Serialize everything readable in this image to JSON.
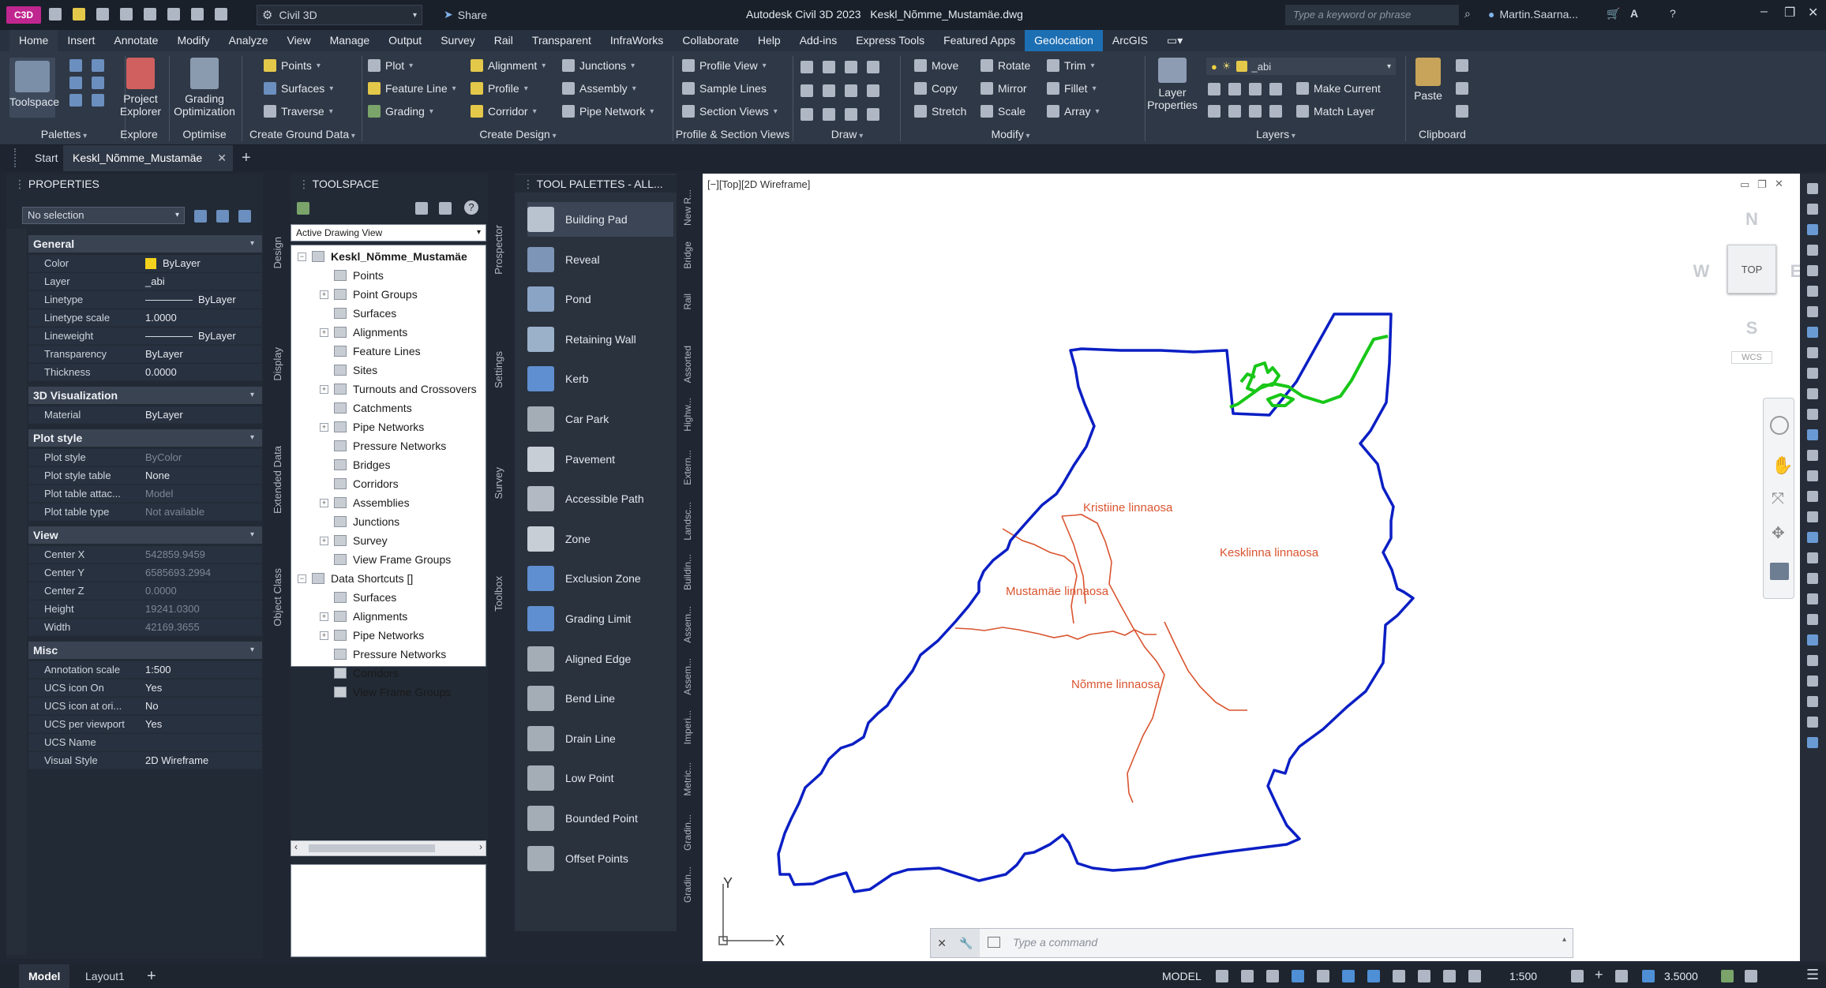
{
  "titlebar": {
    "app_badge": "C3D",
    "workspace": "Civil 3D",
    "share": "Share",
    "title": "Autodesk Civil 3D 2023",
    "file": "Keskl_Nõmme_Mustamäe.dwg",
    "search_placeholder": "Type a keyword or phrase",
    "user": "Martin.Saarna..."
  },
  "menu": [
    "Home",
    "Insert",
    "Annotate",
    "Modify",
    "Analyze",
    "View",
    "Manage",
    "Output",
    "Survey",
    "Rail",
    "Transparent",
    "InfraWorks",
    "Collaborate",
    "Help",
    "Add-ins",
    "Express Tools",
    "Featured Apps",
    "Geolocation",
    "ArcGIS"
  ],
  "ribbon": {
    "palettes": {
      "toolspace": "Toolspace",
      "label": "Palettes"
    },
    "explore": {
      "project_explorer_1": "Project",
      "project_explorer_2": "Explorer",
      "label": "Explore"
    },
    "optimise": {
      "grading_1": "Grading",
      "grading_2": "Optimization",
      "label": "Optimise"
    },
    "ground": {
      "points": "Points",
      "surfaces": "Surfaces",
      "traverse": "Traverse",
      "label": "Create Ground Data"
    },
    "design": {
      "plot": "Plot",
      "feature_line": "Feature Line",
      "grading": "Grading",
      "alignment": "Alignment",
      "profile": "Profile",
      "corridor": "Corridor",
      "junctions": "Junctions",
      "assembly": "Assembly",
      "pipe_network": "Pipe Network",
      "label": "Create Design"
    },
    "profile_views": {
      "profile_view": "Profile View",
      "sample_lines": "Sample Lines",
      "section_views": "Section Views",
      "label": "Profile & Section Views"
    },
    "draw": {
      "label": "Draw"
    },
    "modify": {
      "move": "Move",
      "copy": "Copy",
      "stretch": "Stretch",
      "rotate": "Rotate",
      "mirror": "Mirror",
      "scale": "Scale",
      "trim": "Trim",
      "fillet": "Fillet",
      "array": "Array",
      "label": "Modify"
    },
    "layers": {
      "layer_1": "Layer",
      "layer_2": "Properties",
      "current_layer": "_abi",
      "make_current": "Make Current",
      "match_layer": "Match Layer",
      "label": "Layers"
    },
    "clipboard": {
      "paste": "Paste",
      "label": "Clipboard"
    }
  },
  "doctabs": {
    "start": "Start",
    "active": "Keskl_Nõmme_Mustamäe"
  },
  "properties": {
    "header": "PROPERTIES",
    "selection": "No selection",
    "sections": [
      {
        "title": "General",
        "rows": [
          [
            "Color",
            "ByLayer"
          ],
          [
            "Layer",
            "_abi"
          ],
          [
            "Linetype",
            "ByLayer"
          ],
          [
            "Linetype scale",
            "1.0000"
          ],
          [
            "Lineweight",
            "ByLayer"
          ],
          [
            "Transparency",
            "ByLayer"
          ],
          [
            "Thickness",
            "0.0000"
          ]
        ]
      },
      {
        "title": "3D Visualization",
        "rows": [
          [
            "Material",
            "ByLayer"
          ]
        ]
      },
      {
        "title": "Plot style",
        "rows": [
          [
            "Plot style",
            "ByColor"
          ],
          [
            "Plot style table",
            "None"
          ],
          [
            "Plot table attac...",
            "Model"
          ],
          [
            "Plot table type",
            "Not available"
          ]
        ]
      },
      {
        "title": "View",
        "rows": [
          [
            "Center X",
            "542859.9459"
          ],
          [
            "Center Y",
            "6585693.2994"
          ],
          [
            "Center Z",
            "0.0000"
          ],
          [
            "Height",
            "19241.0300"
          ],
          [
            "Width",
            "42169.3655"
          ]
        ]
      },
      {
        "title": "Misc",
        "rows": [
          [
            "Annotation scale",
            "1:500"
          ],
          [
            "UCS icon On",
            "Yes"
          ],
          [
            "UCS icon at ori...",
            "No"
          ],
          [
            "UCS per viewport",
            "Yes"
          ],
          [
            "UCS Name",
            ""
          ],
          [
            "Visual Style",
            "2D Wireframe"
          ]
        ]
      }
    ],
    "side_tabs": [
      "Design",
      "Display",
      "Extended Data",
      "Object Class"
    ]
  },
  "toolspace": {
    "header": "TOOLSPACE",
    "view_select": "Active Drawing View",
    "root": "Keskl_Nõmme_Mustamäe",
    "items": [
      "Points",
      "Point Groups",
      "Surfaces",
      "Alignments",
      "Feature Lines",
      "Sites",
      "Turnouts and Crossovers",
      "Catchments",
      "Pipe Networks",
      "Pressure Networks",
      "Bridges",
      "Corridors",
      "Assemblies",
      "Junctions",
      "Survey",
      "View Frame Groups"
    ],
    "shortcuts_root": "Data Shortcuts []",
    "shortcuts": [
      "Surfaces",
      "Alignments",
      "Pipe Networks",
      "Pressure Networks",
      "Corridors",
      "View Frame Groups"
    ],
    "side_tabs": [
      "Prospector",
      "Settings",
      "Survey",
      "Toolbox"
    ]
  },
  "palettes": {
    "header": "TOOL PALETTES - ALL...",
    "items": [
      "Building Pad",
      "Reveal",
      "Pond",
      "Retaining Wall",
      "Kerb",
      "Car Park",
      "Pavement",
      "Accessible Path",
      "Zone",
      "Exclusion Zone",
      "Grading Limit",
      "Aligned Edge",
      "Bend Line",
      "Drain Line",
      "Low Point",
      "Bounded Point",
      "Offset Points"
    ],
    "side_tabs": [
      "New R...",
      "Bridge",
      "Rail",
      "Assorted",
      "Highw...",
      "Extern...",
      "Landsc...",
      "Buildin...",
      "Assem...",
      "Assem...",
      "Imperi...",
      "Metric...",
      "Gradin...",
      "Gradin..."
    ]
  },
  "viewport": {
    "label": "[−][Top][2D Wireframe]",
    "compass": {
      "n": "N",
      "s": "S",
      "e": "E",
      "w": "W",
      "top": "TOP",
      "wcs": "WCS"
    },
    "districts": [
      "Kristiine linnaosa",
      "Kesklinna linnaosa",
      "Mustamäe linnaosa",
      "Nõmme linnaosa"
    ],
    "ucs_x": "X",
    "ucs_y": "Y"
  },
  "command": {
    "placeholder": "Type a command"
  },
  "status": {
    "model_tab": "Model",
    "layout_tab": "Layout1",
    "model": "MODEL",
    "scale": "1:500",
    "value": "3.5000"
  },
  "colors": {
    "boundary": "#0b1fc4",
    "districts": "#d9542f",
    "parks": "#18c718",
    "geo_tab": "#1d6fb3"
  }
}
